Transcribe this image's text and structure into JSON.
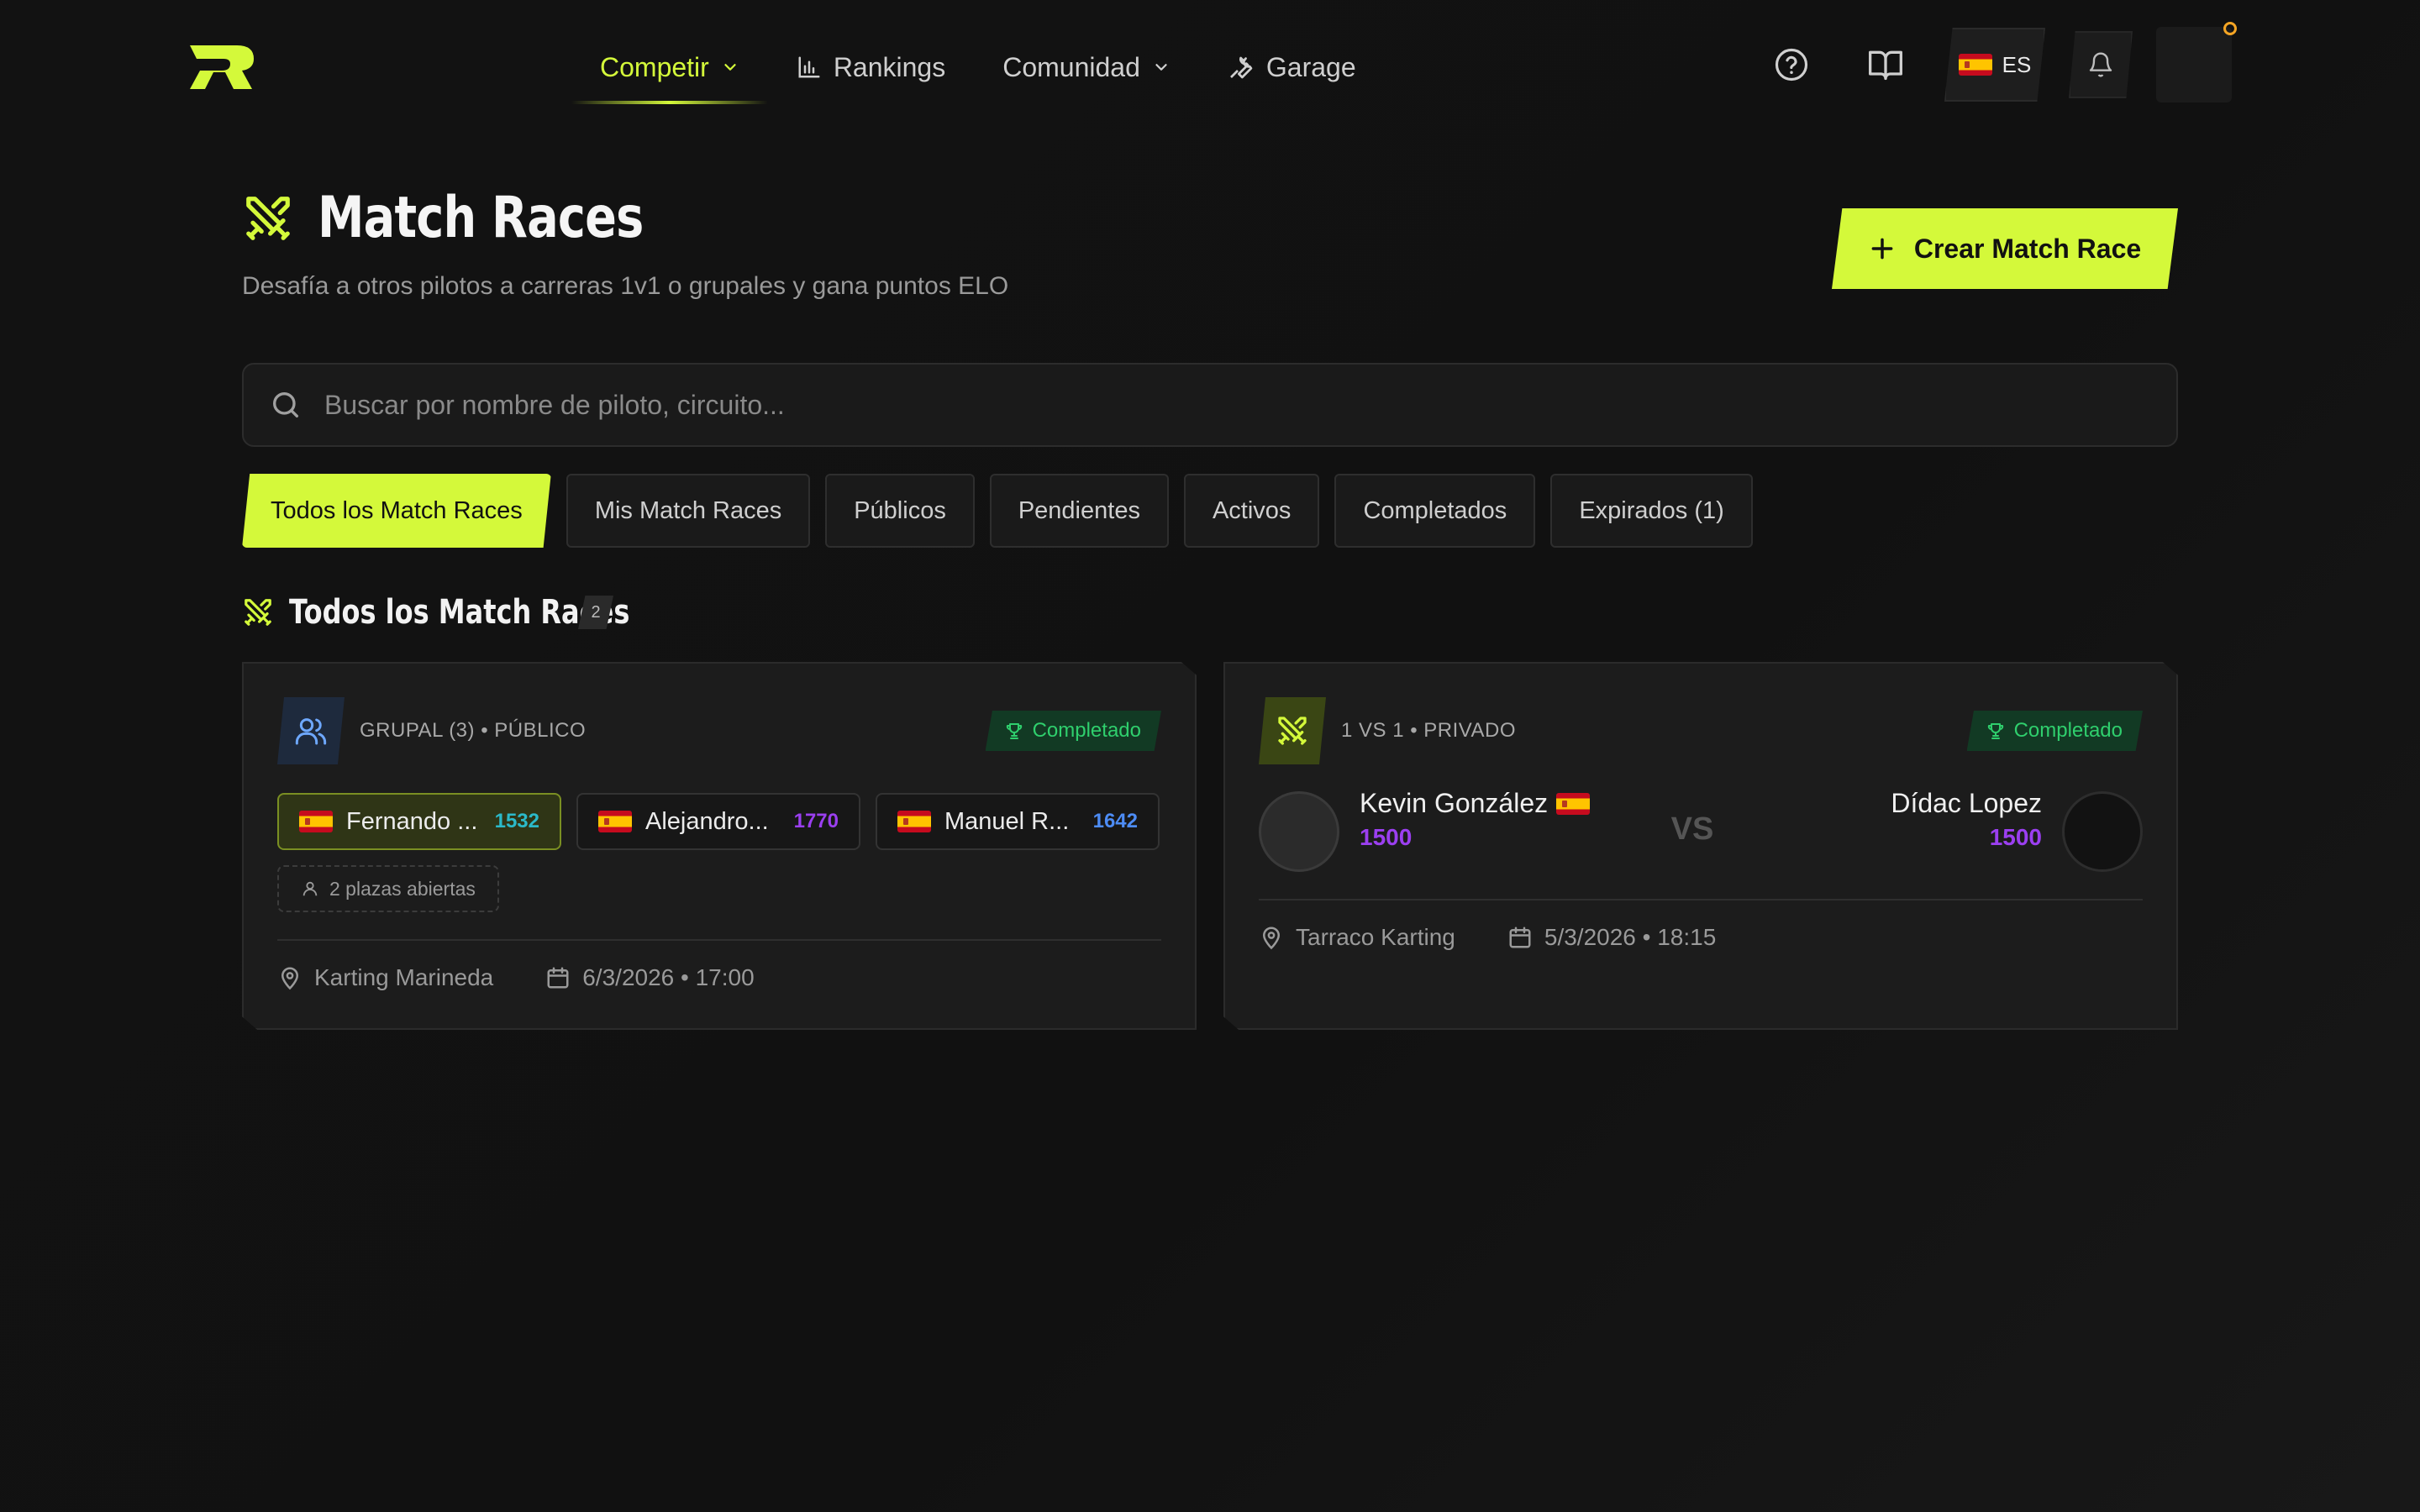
{
  "nav": {
    "items": [
      {
        "label": "Competir",
        "icon": "chevron-down-icon",
        "active": true
      },
      {
        "label": "Rankings",
        "icon": "bar-chart-icon"
      },
      {
        "label": "Comunidad",
        "icon": "chevron-down-icon"
      },
      {
        "label": "Garage",
        "icon": "wrench-icon"
      }
    ],
    "language": "ES"
  },
  "page": {
    "title": "Match Races",
    "subtitle": "Desafía a otros pilotos a carreras 1v1 o grupales y gana puntos ELO",
    "create_button": "Crear Match Race"
  },
  "search": {
    "placeholder": "Buscar por nombre de piloto, circuito..."
  },
  "tabs": [
    {
      "label": "Todos los Match Races",
      "active": true
    },
    {
      "label": "Mis Match Races"
    },
    {
      "label": "Públicos"
    },
    {
      "label": "Pendientes"
    },
    {
      "label": "Activos"
    },
    {
      "label": "Completados"
    },
    {
      "label": "Expirados (1)"
    }
  ],
  "section": {
    "title": "Todos los Match Races",
    "count": "2"
  },
  "cards": [
    {
      "type_label": "GRUPAL (3) • PÚBLICO",
      "status": "Completado",
      "players": [
        {
          "name": "Fernando ...",
          "elo": "1532",
          "elo_color": "#2bb9c9"
        },
        {
          "name": "Alejandro...",
          "elo": "1770",
          "elo_color": "#9b3ff0"
        },
        {
          "name": "Manuel R...",
          "elo": "1642",
          "elo_color": "#4d8cf5"
        }
      ],
      "open_slots": "2 plazas abiertas",
      "location": "Karting Marineda",
      "datetime": "6/3/2026 • 17:00"
    },
    {
      "type_label": "1 VS 1 • PRIVADO",
      "status": "Completado",
      "player_left": {
        "name": "Kevin González",
        "elo": "1500"
      },
      "player_right": {
        "name": "Dídac Lopez",
        "elo": "1500"
      },
      "vs_label": "VS",
      "location": "Tarraco Karting",
      "datetime": "5/3/2026 • 18:15"
    }
  ],
  "colors": {
    "accent": "#d4f93a",
    "background": "#121212",
    "status_green": "#2fcf6d",
    "elo_purple": "#9b3ff0"
  }
}
